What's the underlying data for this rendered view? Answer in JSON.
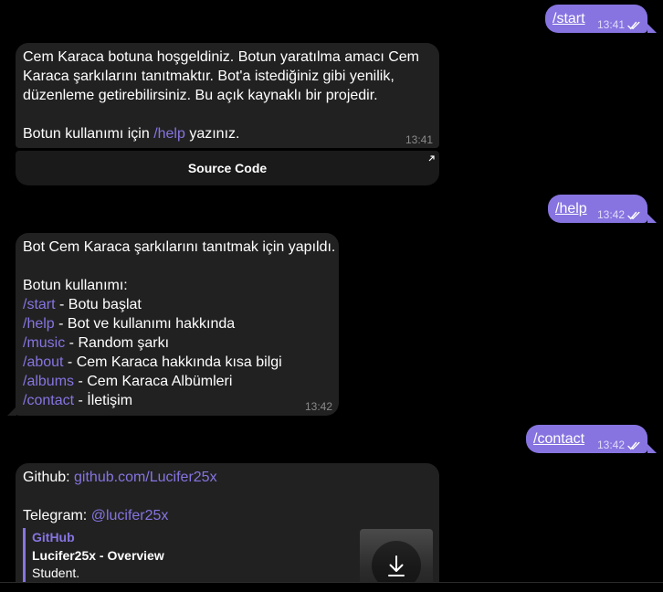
{
  "messages": {
    "m1_out": {
      "text": "/start",
      "time": "13:41"
    },
    "m2_in": {
      "line1": "Cem Karaca botuna hoşgeldiniz. Botun yaratılma amacı Cem",
      "line2": "Karaca şarkılarını tanıtmaktır. Bot'a istediğiniz gibi yenilik,",
      "line3": "düzenleme getirebilirsiniz. Bu açık kaynaklı bir projedir.",
      "usage_prefix": "Botun kullanımı için ",
      "usage_cmd": "/help",
      "usage_suffix": " yazınız.",
      "time": "13:41",
      "button_label": "Source Code"
    },
    "m3_out": {
      "text": "/help",
      "time": "13:42"
    },
    "m4_in": {
      "intro": "Bot Cem Karaca şarkılarını tanıtmak için yapıldı.",
      "usage_title": "Botun kullanımı:",
      "commands": [
        {
          "cmd": "/start",
          "desc": " - Botu başlat"
        },
        {
          "cmd": "/help",
          "desc": " - Bot ve kullanımı hakkında"
        },
        {
          "cmd": "/music",
          "desc": " - Random şarkı"
        },
        {
          "cmd": "/about",
          "desc": " - Cem Karaca hakkında kısa bilgi"
        },
        {
          "cmd": "/albums",
          "desc": " - Cem Karaca Albümleri"
        },
        {
          "cmd": "/contact",
          "desc": " - İletişim"
        }
      ],
      "time": "13:42"
    },
    "m5_out": {
      "text": "/contact",
      "time": "13:42"
    },
    "m6_in": {
      "github_label": "Github: ",
      "github_link": "github.com/Lucifer25x",
      "telegram_label": "Telegram: ",
      "telegram_link": "@lucifer25x",
      "preview": {
        "site": "GitHub",
        "title": "Lucifer25x - Overview",
        "description": "Student."
      }
    }
  },
  "icons": {
    "read": "double-check-icon",
    "open_link": "external-arrow-icon",
    "download": "download-icon"
  },
  "colors": {
    "background": "#000000",
    "outgoing": "#8774e1",
    "incoming": "#212121",
    "link": "#8774e1"
  }
}
